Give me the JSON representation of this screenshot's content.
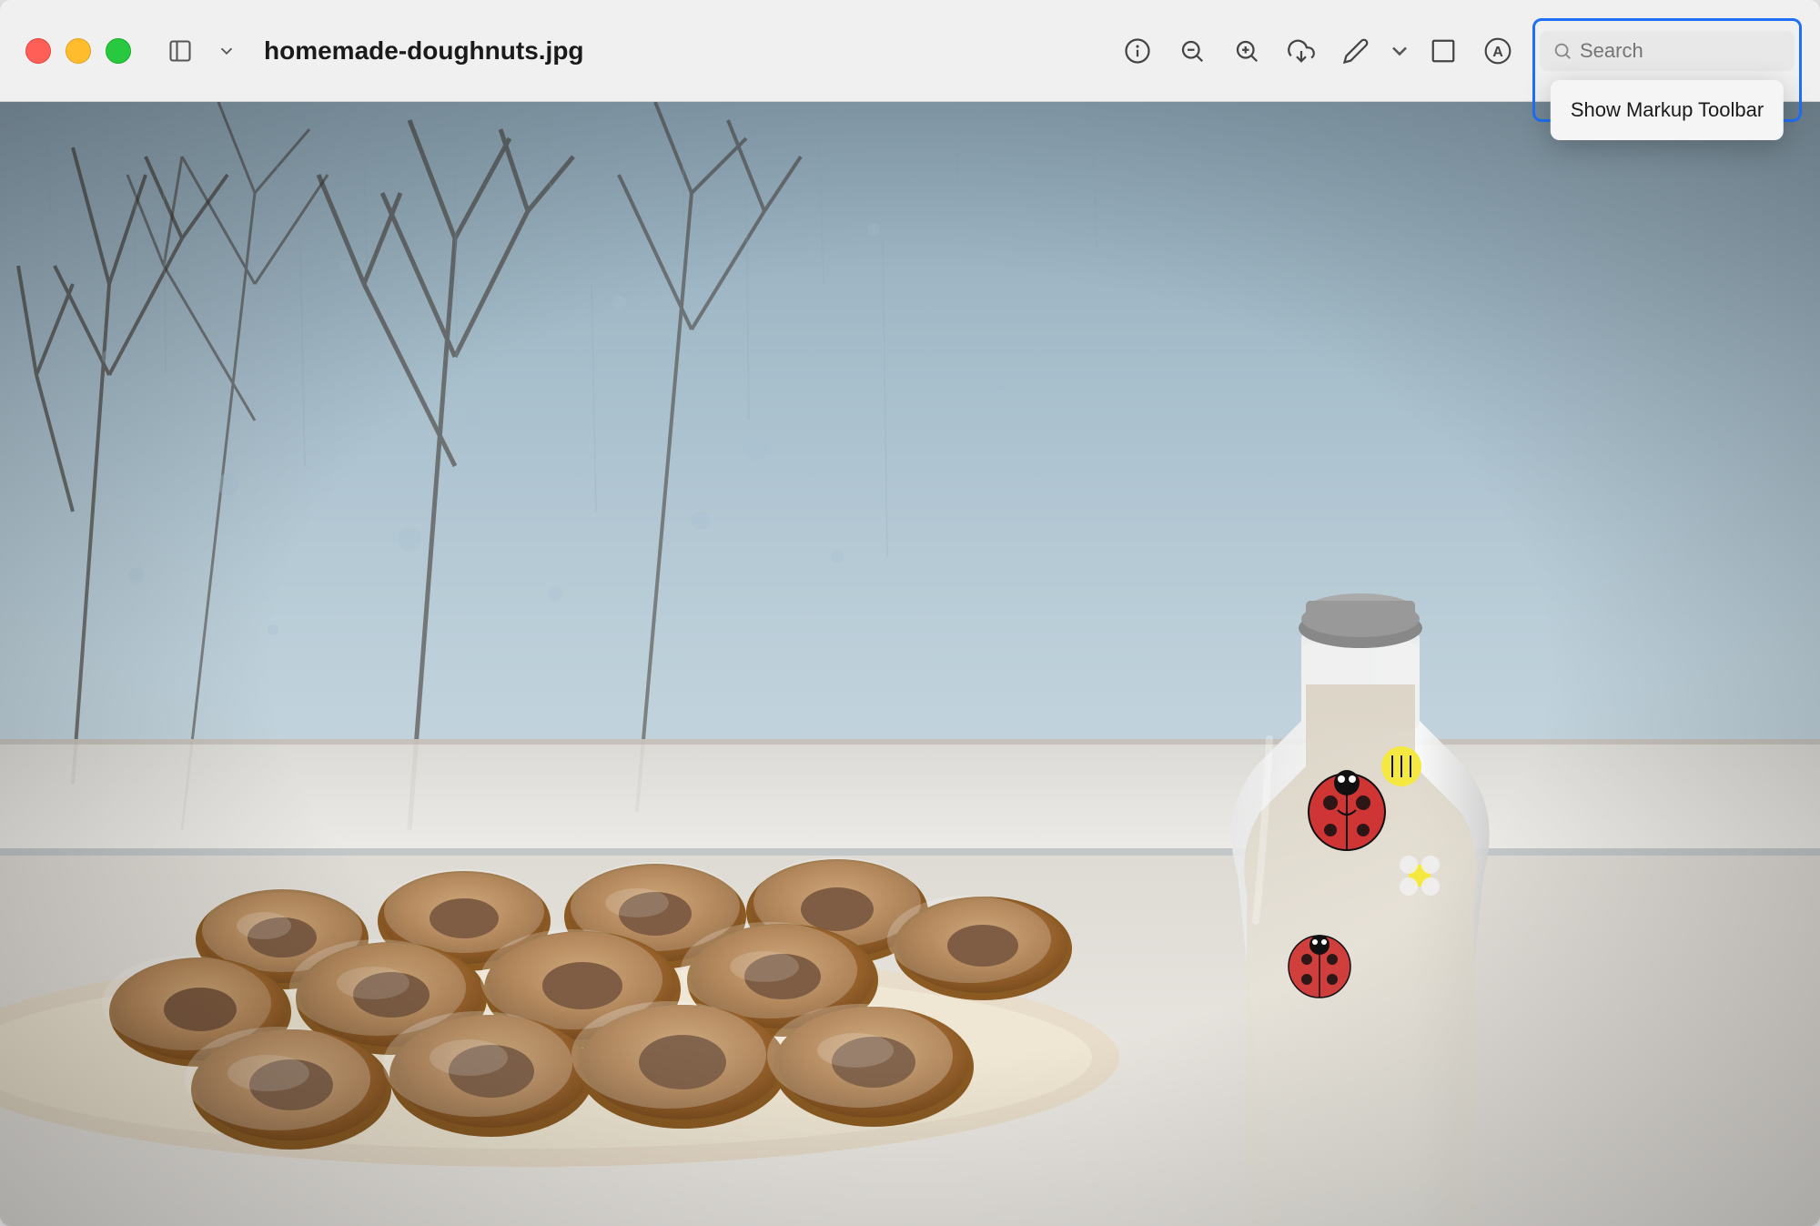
{
  "window": {
    "title": "homemade-doughnuts.jpg"
  },
  "titlebar": {
    "traffic_lights": {
      "close_color": "#ff5f57",
      "minimize_color": "#ffbd2e",
      "maximize_color": "#28c940"
    },
    "filename": "homemade-doughnuts.jpg",
    "buttons": {
      "info": "ℹ",
      "zoom_out": "zoom-out-icon",
      "zoom_in": "zoom-in-icon",
      "share": "share-icon",
      "pencil": "pencil-icon",
      "chevron_down": "chevron-down-icon",
      "crop": "crop-icon",
      "markup": "markup-icon"
    }
  },
  "search": {
    "placeholder": "Search",
    "value": ""
  },
  "dropdown": {
    "show_markup_toolbar": "Show Markup Toolbar"
  },
  "highlight_box": {
    "border_color": "#1e6ff5"
  }
}
